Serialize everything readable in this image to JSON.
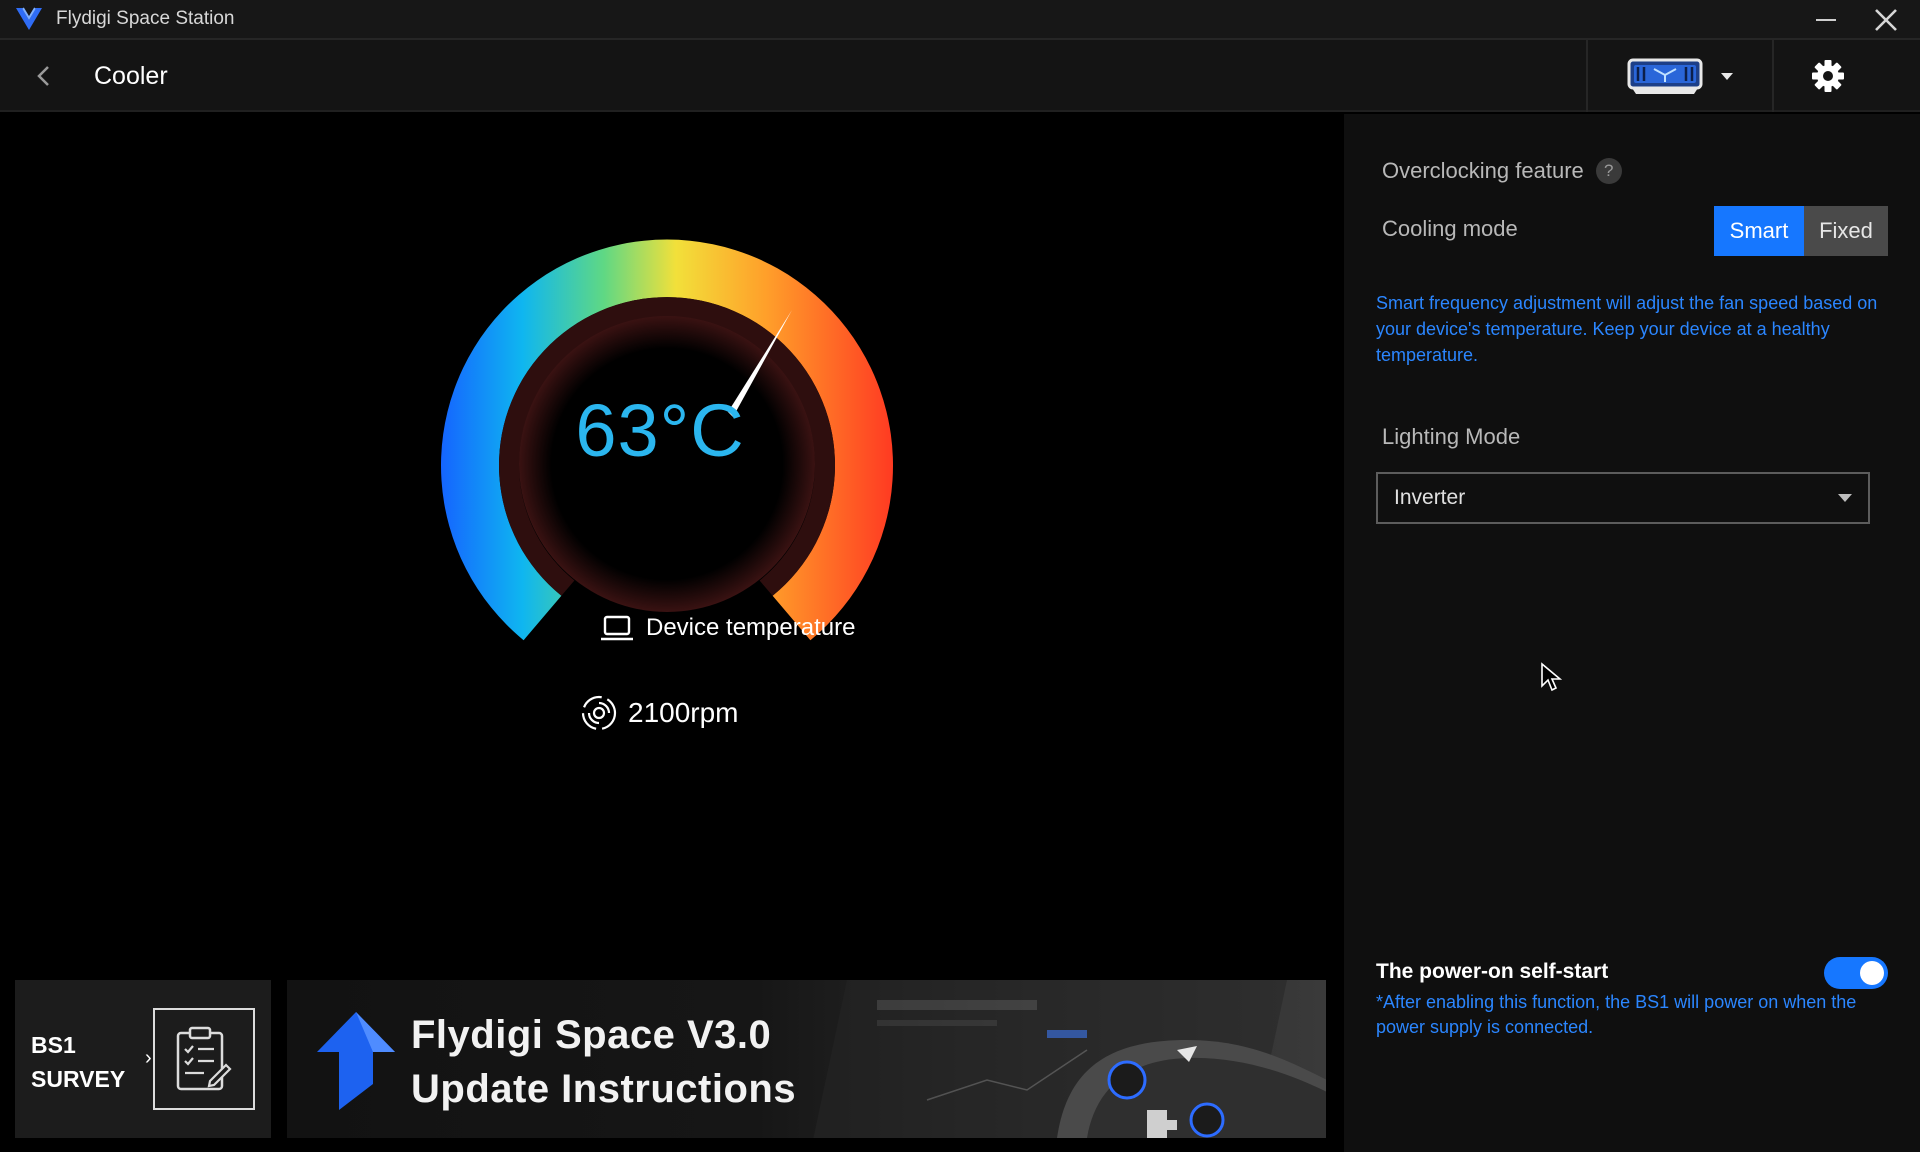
{
  "window": {
    "title": "Flydigi Space Station",
    "minimize_icon": "minimize-icon",
    "close_icon": "close-icon"
  },
  "header": {
    "back_icon": "chevron-left-icon",
    "title": "Cooler",
    "device_icon": "cooler-device-icon",
    "settings_icon": "gear-icon"
  },
  "gauge": {
    "temperature": "63°C",
    "temperature_celsius": 63,
    "label": "Device temperature",
    "fan_speed": "2100rpm"
  },
  "banners": {
    "survey": {
      "line1": "BS1",
      "line2": "SURVEY",
      "arrow": "›"
    },
    "update": {
      "line1": "Flydigi Space V3.0",
      "line2": "Update Instructions"
    }
  },
  "panel": {
    "overclocking_label": "Overclocking feature",
    "help": "?",
    "cooling_mode_label": "Cooling mode",
    "cooling_modes": [
      "Smart",
      "Fixed"
    ],
    "cooling_mode_selected": "Smart",
    "smart_description": "Smart frequency adjustment will adjust the fan speed based on your device's temperature. Keep your device at a healthy temperature.",
    "lighting_label": "Lighting Mode",
    "lighting_value": "Inverter",
    "self_start_label": "The power-on self-start",
    "self_start_enabled": true,
    "self_start_description": "*After enabling this function, the BS1 will power on when the power supply is connected."
  },
  "colors": {
    "accent": "#1677ff",
    "temperature_text": "#2bb6ef",
    "description_text": "#2b86ff"
  }
}
